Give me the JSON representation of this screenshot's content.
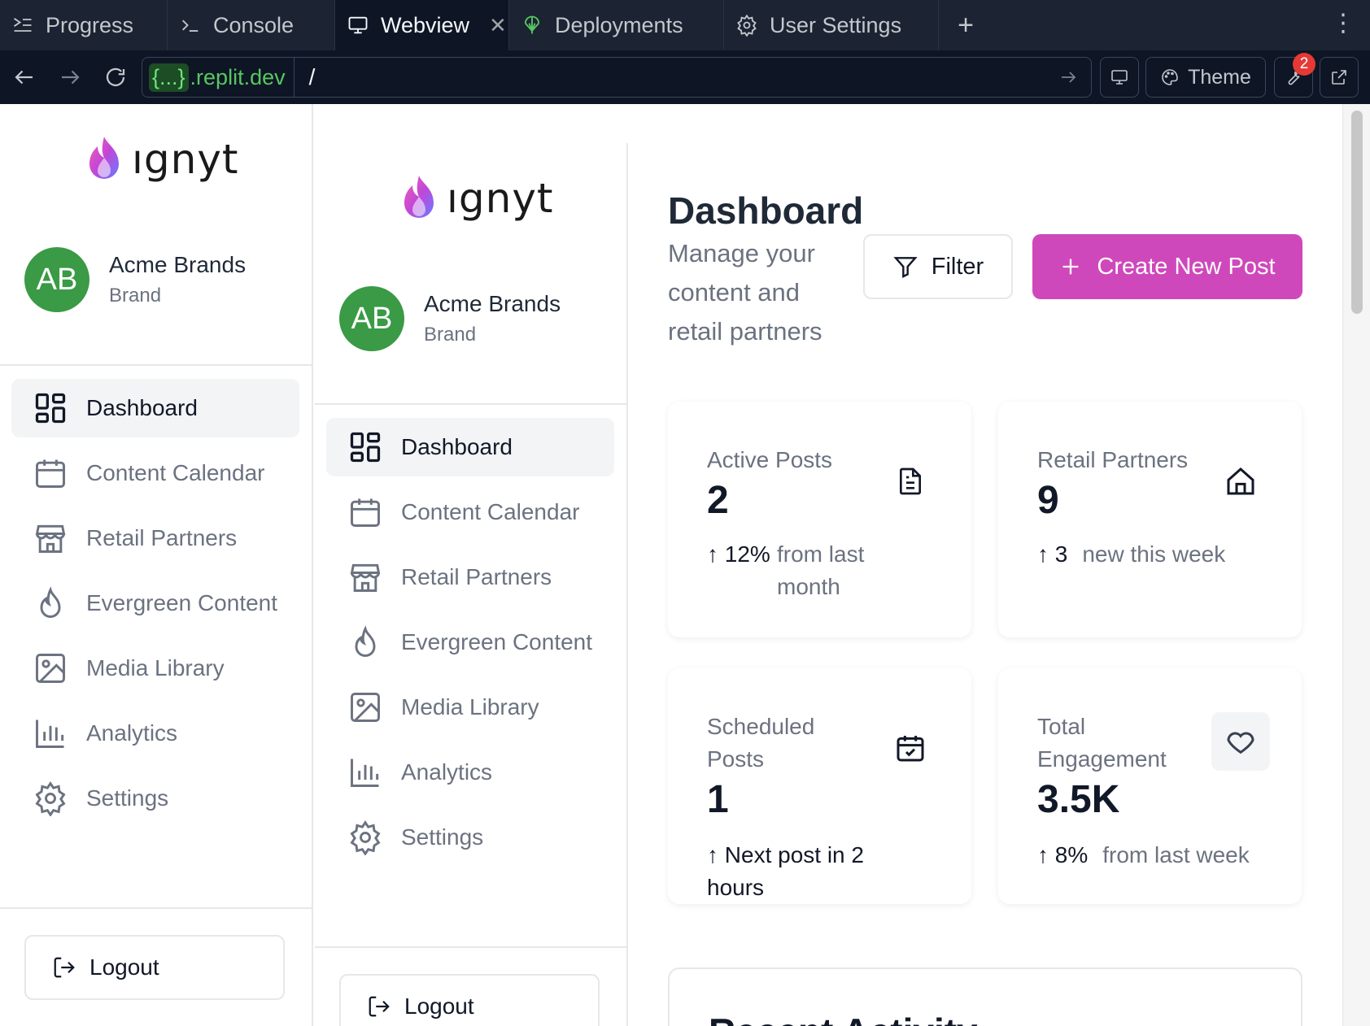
{
  "tabs": [
    {
      "label": "Progress",
      "icon": "progress-icon"
    },
    {
      "label": "Console",
      "icon": "terminal-icon"
    },
    {
      "label": "Webview",
      "icon": "monitor-icon",
      "active": true
    },
    {
      "label": "Deployments",
      "icon": "deploy-icon"
    },
    {
      "label": "User Settings",
      "icon": "gear-icon"
    }
  ],
  "url": {
    "host_braces": "{...}",
    "host_rest": ".replit.dev",
    "path": "/"
  },
  "chrome": {
    "theme_label": "Theme",
    "badge_count": "2"
  },
  "brand": {
    "wordmark": "ıgnyt"
  },
  "profile": {
    "initials": "AB",
    "name": "Acme Brands",
    "role": "Brand"
  },
  "nav": [
    {
      "label": "Dashboard",
      "icon": "dashboard-icon",
      "active": true
    },
    {
      "label": "Content Calendar",
      "icon": "calendar-icon"
    },
    {
      "label": "Retail Partners",
      "icon": "store-icon"
    },
    {
      "label": "Evergreen Content",
      "icon": "flame-icon"
    },
    {
      "label": "Media Library",
      "icon": "image-icon"
    },
    {
      "label": "Analytics",
      "icon": "bar-chart-icon"
    },
    {
      "label": "Settings",
      "icon": "gear-icon"
    }
  ],
  "logout_label": "Logout",
  "page": {
    "title": "Dashboard",
    "subtitle": "Manage your content and retail partners",
    "filter_label": "Filter",
    "create_label": "Create New Post"
  },
  "stats": [
    {
      "label": "Active Posts",
      "value": "2",
      "trend_value": "↑ 12%",
      "trend_text": "from last month",
      "icon": "document-icon"
    },
    {
      "label": "Retail Partners",
      "value": "9",
      "trend_value": "↑ 3",
      "trend_text": "new this week",
      "icon": "home-icon"
    },
    {
      "label": "Scheduled Posts",
      "value": "1",
      "trend_value": "↑ Next post in 2 hours",
      "trend_text": "",
      "icon": "calendar-check-icon"
    },
    {
      "label": "Total Engagement",
      "value": "3.5K",
      "trend_value": "↑ 8%",
      "trend_text": "from last week",
      "icon": "heart-icon"
    }
  ],
  "recent_activity_title": "Recent Activity",
  "colors": {
    "accent": "#cf48bb",
    "avatar": "#3a9a45",
    "chrome_bg": "#1c2333"
  }
}
